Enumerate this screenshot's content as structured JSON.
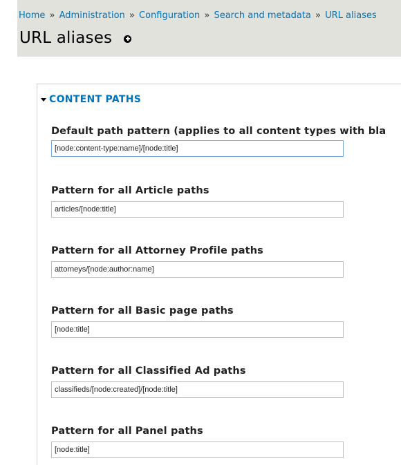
{
  "breadcrumb": {
    "items": [
      "Home",
      "Administration",
      "Configuration",
      "Search and metadata",
      "URL aliases"
    ],
    "separator": "»"
  },
  "page": {
    "title": "URL aliases",
    "shortcut_icon": "add-circle-icon"
  },
  "fieldset": {
    "legend": "CONTENT PATHS",
    "fields": [
      {
        "label": "Default path pattern (applies to all content types with bla",
        "value": "[node:content-type:name]/[node:title]"
      },
      {
        "label": "Pattern for all Article paths",
        "value": "articles/[node:title]"
      },
      {
        "label": "Pattern for all Attorney Profile paths",
        "value": "attorneys/[node:author:name]"
      },
      {
        "label": "Pattern for all Basic page paths",
        "value": "[node:title]"
      },
      {
        "label": "Pattern for all Classified Ad paths",
        "value": "classifieds/[node:created]/[node:title]"
      },
      {
        "label": "Pattern for all Panel paths",
        "value": "[node:title]"
      }
    ]
  },
  "colors": {
    "link": "#0074bd",
    "header_bg": "#e1e2dc"
  }
}
